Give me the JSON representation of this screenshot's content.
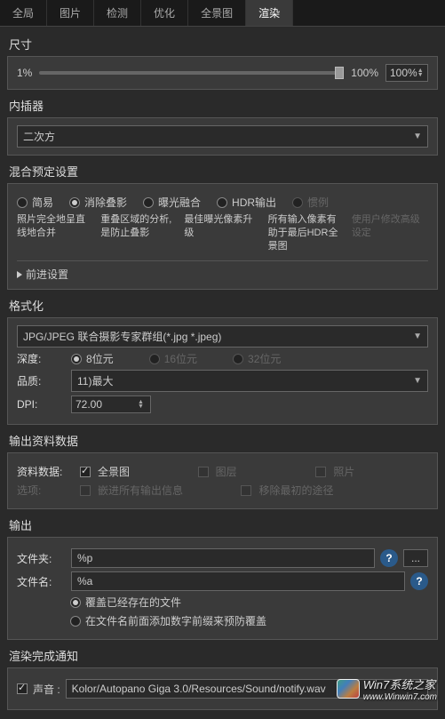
{
  "tabs": [
    "全局",
    "图片",
    "检测",
    "优化",
    "全景图",
    "渲染"
  ],
  "active_tab": 5,
  "size": {
    "title": "尺寸",
    "min": "1%",
    "max": "100%",
    "value": "100%"
  },
  "interp": {
    "title": "内插器",
    "value": "二次方"
  },
  "blend": {
    "title": "混合预定设置",
    "options": [
      "简易",
      "消除叠影",
      "曝光融合",
      "HDR输出",
      "惯例"
    ],
    "selected": 1,
    "descs": [
      "照片完全地呈直线地合并",
      "重叠区域的分析, 是防止叠影",
      "最佳曝光像素升级",
      "所有输入像素有助于最后HDR全景图",
      "使用户修改高级设定"
    ],
    "advanced": "前进设置"
  },
  "format": {
    "title": "格式化",
    "format_value": "JPG/JPEG 联合摄影专家群组(*.jpg *.jpeg)",
    "depth_label": "深度:",
    "depth_options": [
      "8位元",
      "16位元",
      "32位元"
    ],
    "quality_label": "品质:",
    "quality_value": "11)最大",
    "dpi_label": "DPI:",
    "dpi_value": "72.00"
  },
  "outputdata": {
    "title": "输出资料数据",
    "data_label": "资料数据:",
    "panorama": "全景图",
    "layers": "图层",
    "photos": "照片",
    "options_label": "选项:",
    "embed": "嵌进所有输出信息",
    "remove": "移除最初的途径"
  },
  "output": {
    "title": "输出",
    "folder_label": "文件夹:",
    "folder_value": "%p",
    "filename_label": "文件名:",
    "filename_value": "%a",
    "overwrite": "覆盖已经存在的文件",
    "prefix": "在文件名前面添加数字前缀来预防覆盖"
  },
  "notify": {
    "title": "渲染完成通知",
    "sound_label": "声音 :",
    "sound_value": "Kolor/Autopano Giga 3.0/Resources/Sound/notify.wav"
  },
  "watermark": {
    "line1": "Win7系统之家",
    "line2": "www.Winwin7.com"
  }
}
